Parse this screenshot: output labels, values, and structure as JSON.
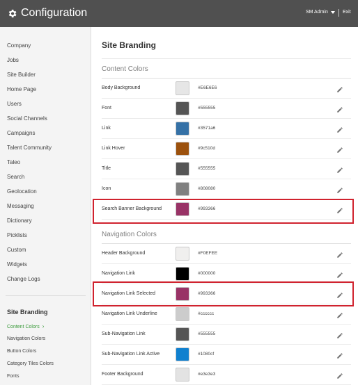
{
  "header": {
    "title": "Configuration",
    "user": "SM Admin",
    "exit": "Exit"
  },
  "sidebar": {
    "items": [
      "Company",
      "Jobs",
      "Site Builder",
      "Home Page",
      "Users",
      "Social Channels",
      "Campaigns",
      "Talent Community",
      "Taleo",
      "Search",
      "Geolocation",
      "Messaging",
      "Dictionary",
      "Picklists",
      "Custom",
      "Widgets",
      "Change Logs"
    ],
    "section_title": "Site Branding",
    "sub_items": [
      "Content Colors",
      "Navigation Colors",
      "Button Colors",
      "Category Tiles Colors",
      "Fonts"
    ],
    "active_sub": "Content Colors"
  },
  "main": {
    "page_title": "Site Branding",
    "content_colors": {
      "title": "Content Colors",
      "rows": [
        {
          "label": "Body Background",
          "hex": "#E6E6E6",
          "color": "#e6e6e6"
        },
        {
          "label": "Font",
          "hex": "#555555",
          "color": "#555555"
        },
        {
          "label": "Link",
          "hex": "#3571a6",
          "color": "#3571a6"
        },
        {
          "label": "Link Hover",
          "hex": "#9c510d",
          "color": "#9c510d"
        },
        {
          "label": "Title",
          "hex": "#555555",
          "color": "#555555"
        },
        {
          "label": "Icon",
          "hex": "#808080",
          "color": "#808080"
        },
        {
          "label": "Search Banner Background",
          "hex": "#993366",
          "color": "#993366"
        }
      ]
    },
    "navigation_colors": {
      "title": "Navigation Colors",
      "rows": [
        {
          "label": "Header Background",
          "hex": "#F0EFEE",
          "color": "#f0efee"
        },
        {
          "label": "Navigation Link",
          "hex": "#000000",
          "color": "#000000"
        },
        {
          "label": "Navigation Link Selected",
          "hex": "#993366",
          "color": "#993366"
        },
        {
          "label": "Navigation Link Underline",
          "hex": "#cccccc",
          "color": "#cccccc"
        },
        {
          "label": "Sub-Navigation Link",
          "hex": "#555555",
          "color": "#555555"
        },
        {
          "label": "Sub-Navigation Link Active",
          "hex": "#1080cf",
          "color": "#1080cf"
        },
        {
          "label": "Footer Background",
          "hex": "#e3e3e3",
          "color": "#e3e3e3"
        }
      ]
    }
  },
  "colors": {
    "header_bg": "#505050",
    "highlight": "#d0222e",
    "active_green": "#3a9a3a"
  }
}
